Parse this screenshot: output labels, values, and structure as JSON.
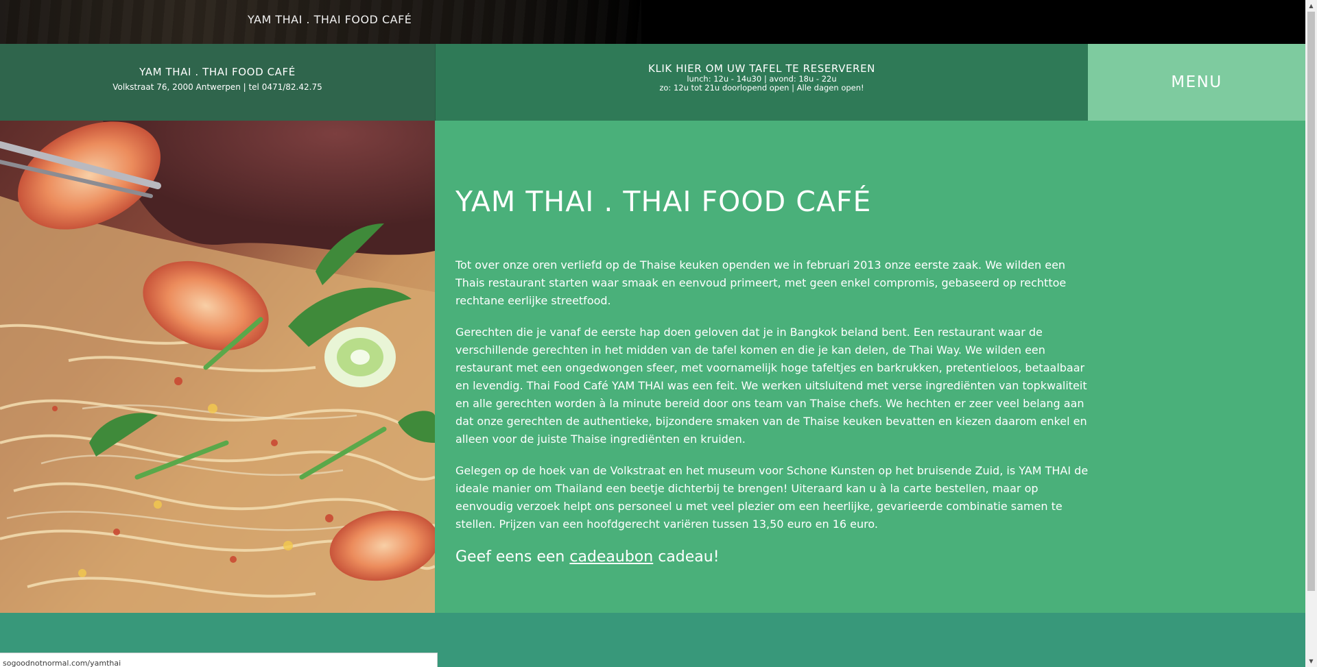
{
  "top_bar": {
    "title": "YAM THAI . THAI FOOD CAFÉ"
  },
  "header": {
    "brand": {
      "name": "YAM THAI . THAI FOOD CAFÉ",
      "address": "Volkstraat 76, 2000 Antwerpen | tel 0471/82.42.75"
    },
    "reservation": {
      "title": "KLIK HIER OM UW TAFEL TE RESERVEREN",
      "hours_line1": "lunch: 12u - 14u30 | avond: 18u - 22u",
      "hours_line2": "zo: 12u tot 21u doorlopend open | Alle dagen open!"
    },
    "menu_label": "MENU"
  },
  "main": {
    "title": "YAM THAI . THAI FOOD CAFÉ",
    "paragraphs": [
      "Tot over onze oren verliefd op de Thaise keuken openden we in februari 2013 onze eerste zaak. We wilden een Thais restaurant starten waar smaak en eenvoud primeert, met geen enkel compromis, gebaseerd op rechttoe rechtane eerlijke streetfood.",
      "Gerechten die je vanaf de eerste hap doen geloven dat je in Bangkok beland bent. Een restaurant waar de verschillende gerechten in het midden van de tafel komen en die je kan delen, de Thai Way. We wilden een restaurant met een ongedwongen sfeer, met voornamelijk hoge tafeltjes en barkrukken, pretentieloos, betaalbaar en levendig. Thai Food Café YAM THAI was een feit. We werken uitsluitend met verse ingrediënten van topkwaliteit en alle gerechten worden à la minute bereid door ons team van Thaise chefs. We hechten er zeer veel belang aan dat onze gerechten de authentieke, bijzondere smaken van de Thaise keuken bevatten en kiezen daarom enkel en alleen voor de juiste Thaise ingrediënten en kruiden.",
      "Gelegen op de hoek van de Volkstraat en het museum voor Schone Kunsten op het bruisende Zuid, is YAM THAI de ideale manier om Thailand een beetje dichterbij te brengen! Uiteraard kan u à la carte bestellen, maar op eenvoudig verzoek helpt ons personeel u met veel plezier om een heerlijke, gevarieerde combinatie samen te stellen. Prijzen van een hoofdgerecht variëren tussen 13,50 euro en 16 euro."
    ],
    "gift": {
      "prefix": "Geef eens een ",
      "link": "cadeaubon",
      "suffix": " cadeau!"
    }
  },
  "status_bar": {
    "url": "sogoodnotnormal.com/yamthai"
  },
  "colors": {
    "brand_bg": "#2f654c",
    "reserve_bg": "#2f7a57",
    "menu_bg": "#7ecb9f",
    "content_bg": "#4ab07a",
    "footer_bg": "#38987a"
  }
}
